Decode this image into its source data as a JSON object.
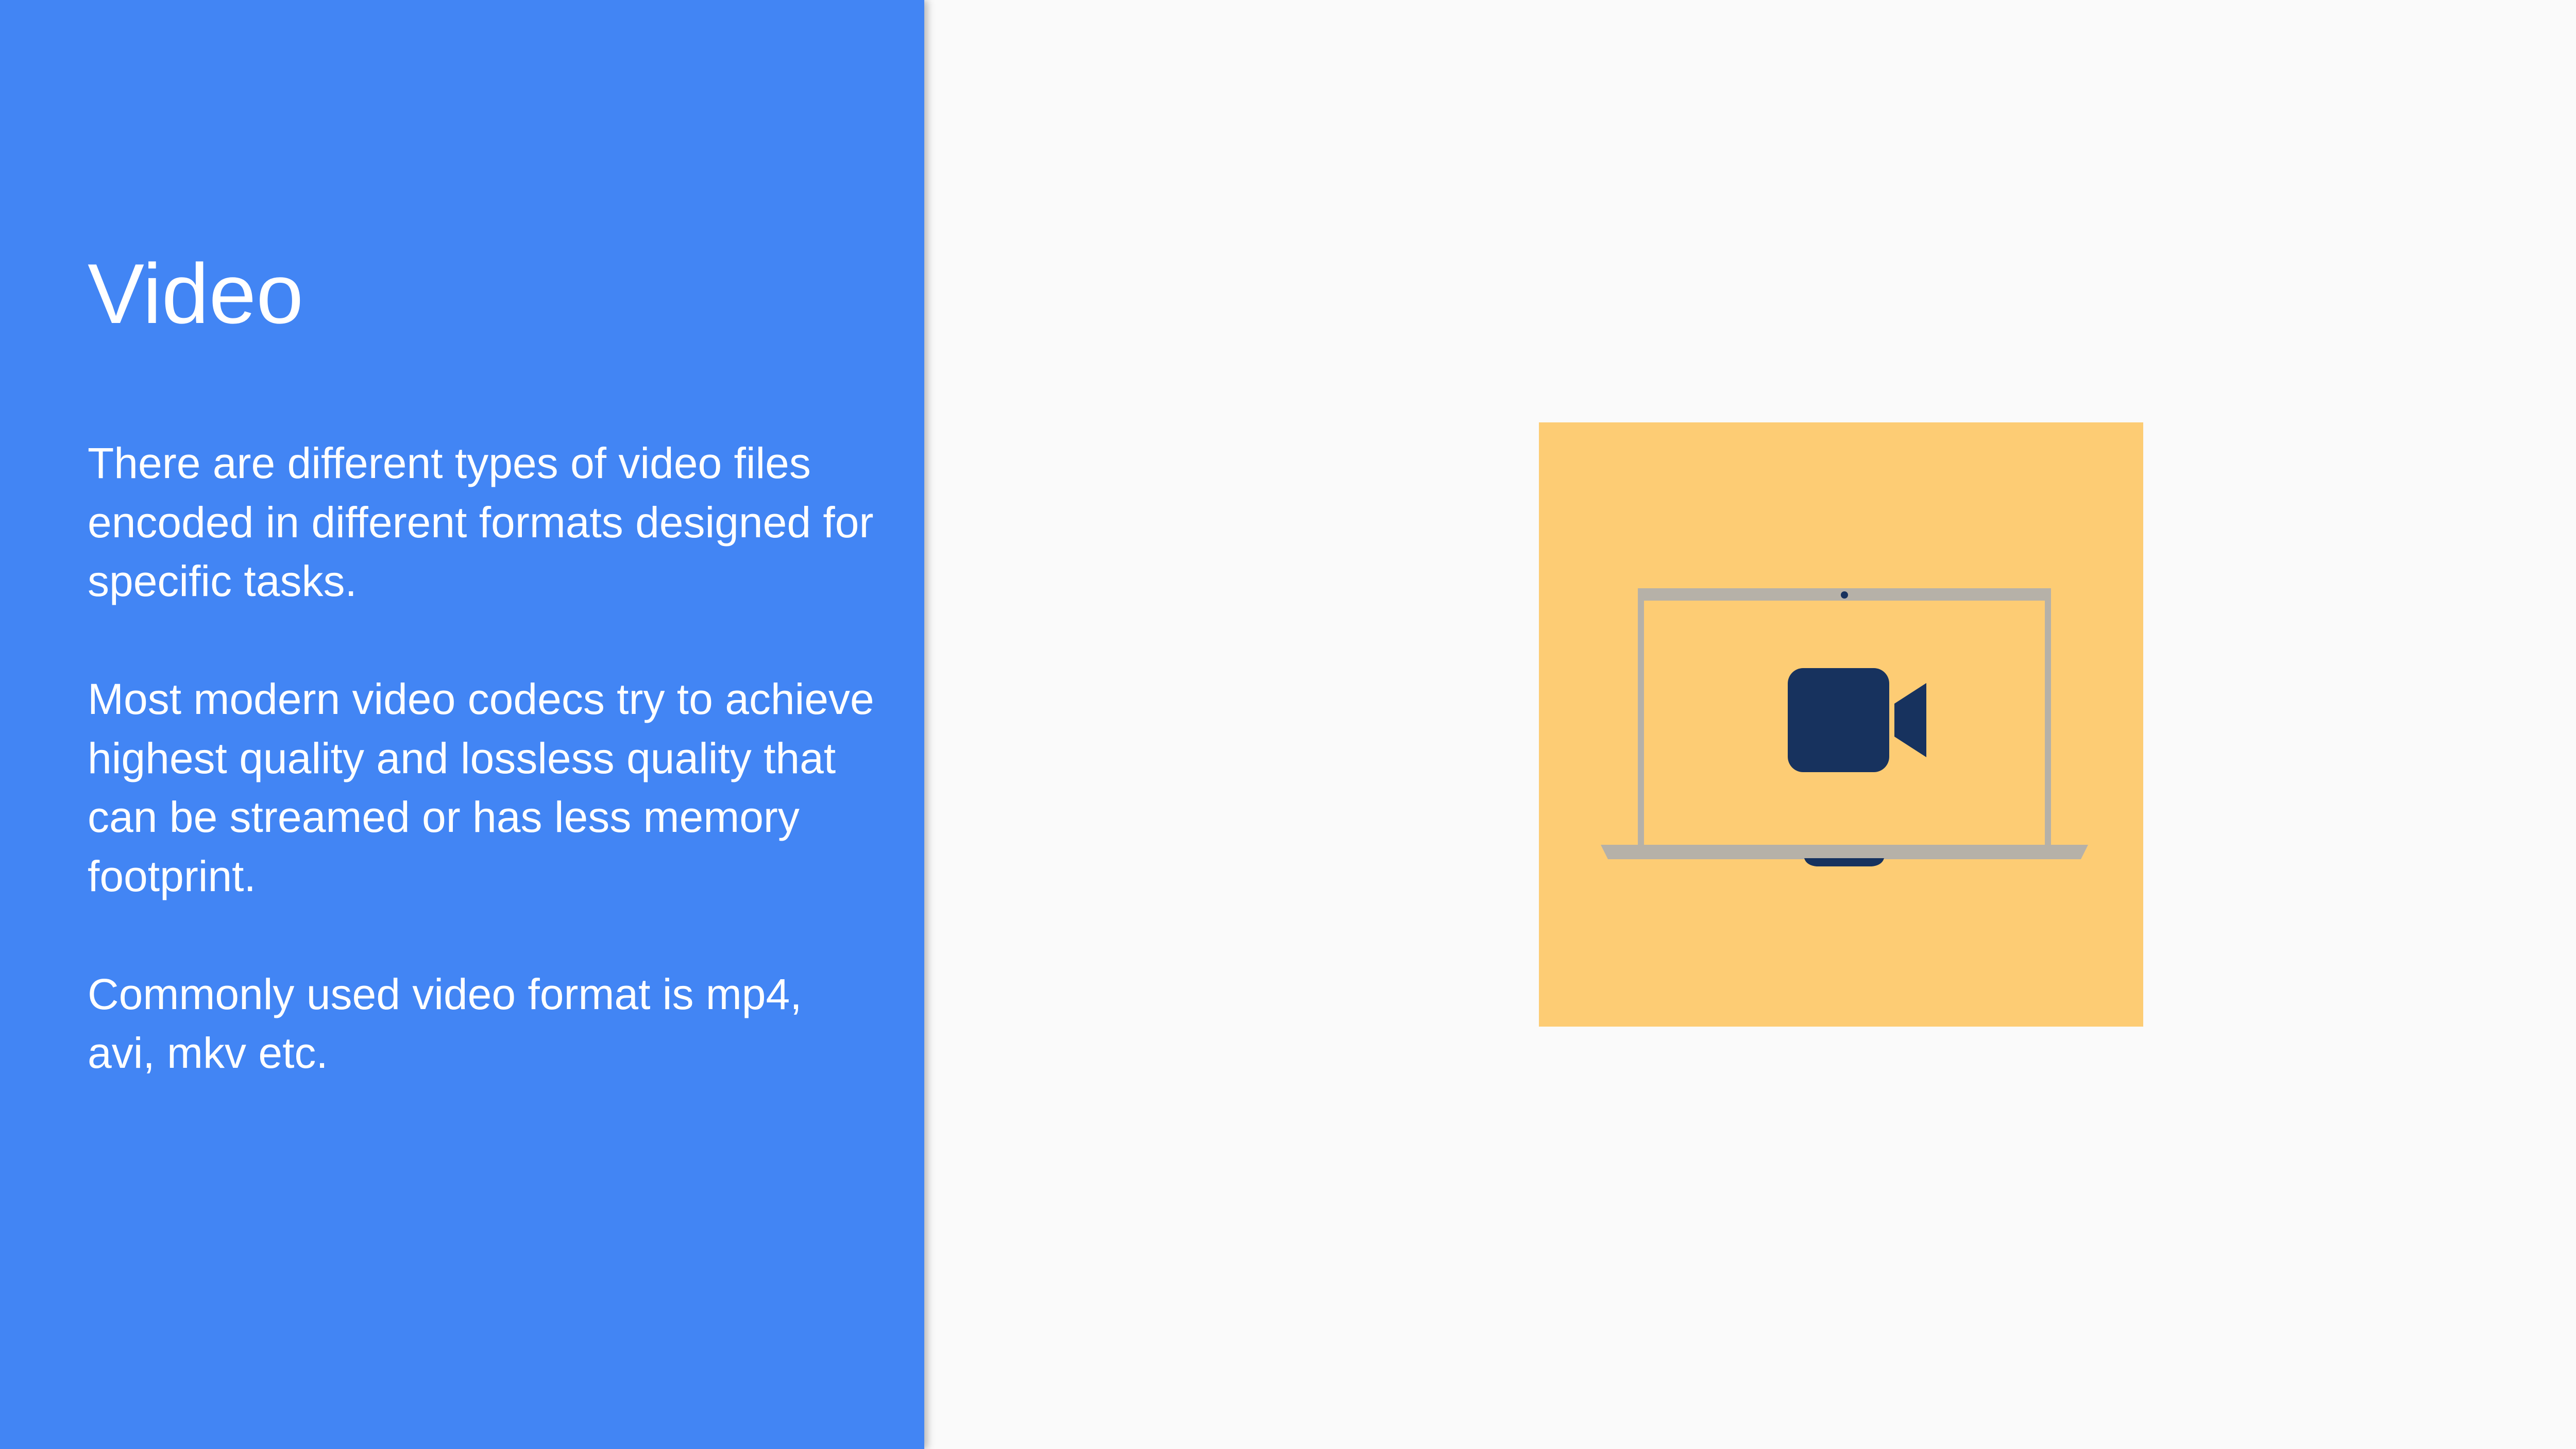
{
  "slide": {
    "title": "Video",
    "paragraphs": [
      "There are different types of video files encoded in different formats designed for specific tasks.",
      "Most modern video codecs try to achieve highest quality and lossless quality that can be streamed or has less memory footprint.",
      "Commonly used video format is mp4, avi, mkv etc."
    ]
  },
  "illustration": {
    "icon": "laptop-video-camera-icon",
    "background_color": "#fdcc74",
    "camera_color": "#17325e",
    "laptop_color": "#b6b1a8"
  },
  "colors": {
    "left_panel": "#4285f4",
    "right_panel": "#fafafa",
    "text": "#ffffff"
  }
}
